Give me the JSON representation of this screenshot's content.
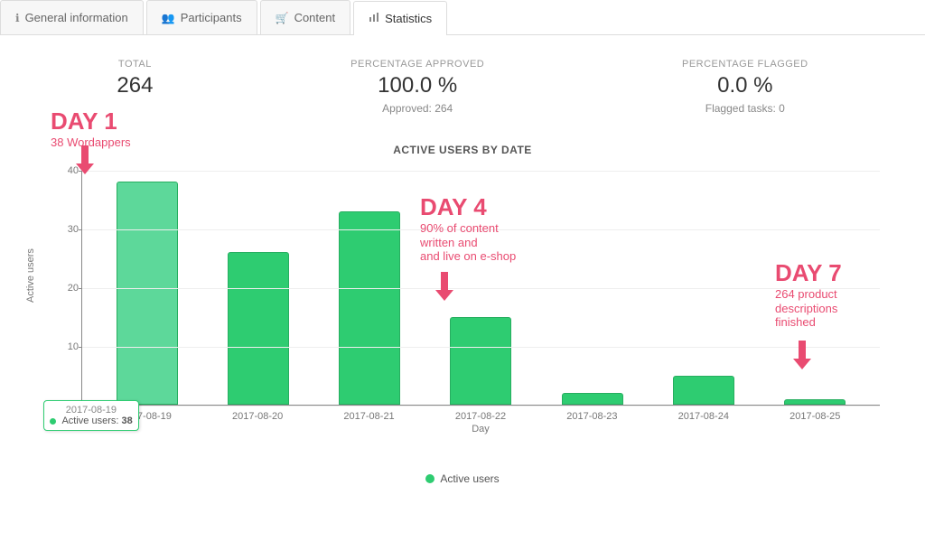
{
  "tabs": [
    {
      "label": "General information",
      "icon": "i"
    },
    {
      "label": "Participants",
      "icon": "👥"
    },
    {
      "label": "Content",
      "icon": "🛒"
    },
    {
      "label": "Statistics",
      "icon": "📊"
    }
  ],
  "stats": {
    "total_label": "TOTAL",
    "total_value": "264",
    "approved_label": "PERCENTAGE APPROVED",
    "approved_value": "100.0 %",
    "approved_sub": "Approved: 264",
    "flagged_label": "PERCENTAGE FLAGGED",
    "flagged_value": "0.0 %",
    "flagged_sub": "Flagged tasks: 0"
  },
  "chart_title": "ACTIVE USERS BY DATE",
  "y_axis_label": "Active users",
  "x_axis_label": "Day",
  "legend_label": "Active users",
  "tooltip": {
    "date": "2017-08-19",
    "label": "Active users:",
    "value": "38"
  },
  "annotations": {
    "day1_head": "DAY 1",
    "day1_sub": "38 Wordappers",
    "day4_head": "DAY 4",
    "day4_sub1": "90% of content",
    "day4_sub2": "written and",
    "day4_sub3": "and live on e-shop",
    "day7_head": "DAY 7",
    "day7_sub1": "264 product",
    "day7_sub2": "descriptions",
    "day7_sub3": "finished"
  },
  "chart_data": {
    "type": "bar",
    "categories": [
      "2017-08-19",
      "2017-08-20",
      "2017-08-21",
      "2017-08-22",
      "2017-08-23",
      "2017-08-24",
      "2017-08-25"
    ],
    "values": [
      38,
      26,
      33,
      15,
      2,
      5,
      1
    ],
    "title": "ACTIVE USERS BY DATE",
    "xlabel": "Day",
    "ylabel": "Active users",
    "ylim": [
      0,
      40
    ],
    "y_ticks": [
      0,
      10,
      20,
      30,
      40
    ],
    "series_name": "Active users",
    "highlight_index": 0
  }
}
